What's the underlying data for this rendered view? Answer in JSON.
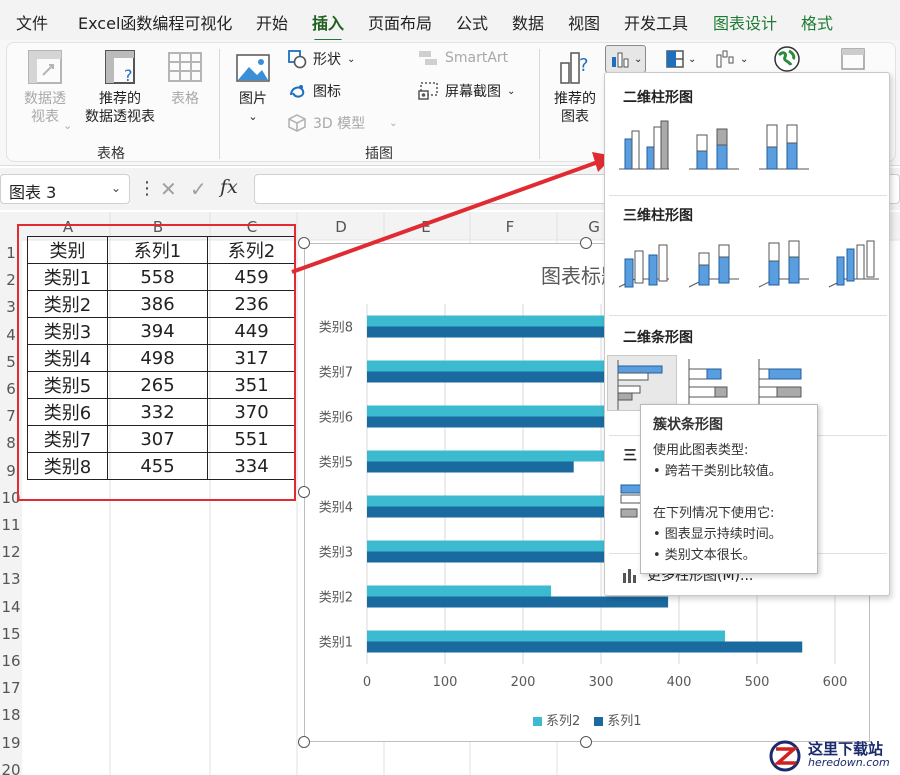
{
  "ribbon": {
    "tabs": [
      {
        "label": "文件"
      },
      {
        "label": "Excel函数编程可视化"
      },
      {
        "label": "开始"
      },
      {
        "label": "插入",
        "active": true
      },
      {
        "label": "页面布局"
      },
      {
        "label": "公式"
      },
      {
        "label": "数据"
      },
      {
        "label": "视图"
      },
      {
        "label": "开发工具"
      },
      {
        "label": "图表设计"
      },
      {
        "label": "格式"
      }
    ],
    "tables_group": {
      "label": "表格",
      "pivot": "数据透\n视表",
      "pivot_dd": "⌄",
      "recommended_pivot": "推荐的\n数据透视表",
      "table": "表格"
    },
    "illustrations_group": {
      "label": "插图",
      "picture": "图片",
      "picture_dd": "⌄",
      "shapes": "形状",
      "icons": "图标",
      "model3d": "3D 模型",
      "smartart": "SmartArt",
      "screenshot": "屏幕截图"
    },
    "charts_group": {
      "recommended_charts": "推荐的\n图表"
    }
  },
  "formula_bar": {
    "name_box": "图表 3",
    "name_dd": "⌄",
    "more": "⋮",
    "cancel": "✕",
    "enter": "✓",
    "fx": "fx",
    "value": ""
  },
  "sheet": {
    "columns": [
      "A",
      "B",
      "C",
      "D",
      "E",
      "F",
      "G"
    ],
    "rows": [
      "1",
      "2",
      "3",
      "4",
      "5",
      "6",
      "7",
      "8",
      "9",
      "10",
      "11",
      "12",
      "13",
      "14",
      "15",
      "16",
      "17",
      "18",
      "19",
      "20"
    ],
    "table_header": [
      "类别",
      "系列1",
      "系列2"
    ],
    "table_rows": [
      [
        "类别1",
        "558",
        "459"
      ],
      [
        "类别2",
        "386",
        "236"
      ],
      [
        "类别3",
        "394",
        "449"
      ],
      [
        "类别4",
        "498",
        "317"
      ],
      [
        "类别5",
        "265",
        "351"
      ],
      [
        "类别6",
        "332",
        "370"
      ],
      [
        "类别7",
        "307",
        "551"
      ],
      [
        "类别8",
        "455",
        "334"
      ]
    ]
  },
  "chart_data": {
    "type": "bar",
    "orientation": "horizontal",
    "title": "图表标题",
    "categories": [
      "类别1",
      "类别2",
      "类别3",
      "类别4",
      "类别5",
      "类别6",
      "类别7",
      "类别8"
    ],
    "series": [
      {
        "name": "系列1",
        "color": "#1a6aa0",
        "values": [
          558,
          386,
          394,
          498,
          265,
          332,
          307,
          455
        ]
      },
      {
        "name": "系列2",
        "color": "#3bbad0",
        "values": [
          459,
          236,
          449,
          317,
          351,
          370,
          551,
          334
        ]
      }
    ],
    "xlim": [
      0,
      600
    ],
    "xticks": [
      0,
      100,
      200,
      300,
      400,
      500,
      600
    ],
    "grid": true,
    "legend": "bottom"
  },
  "dropdown": {
    "section_2d_column": "二维柱形图",
    "section_3d_column": "三维柱形图",
    "section_2d_bar": "二维条形图",
    "section_3d_bar_partial": "三",
    "more_charts": "更多柱形图(M)..."
  },
  "tooltip": {
    "title": "簇状条形图",
    "line1": "使用此图表类型:",
    "line2": "• 跨若干类别比较值。",
    "line3": "在下列情况下使用它:",
    "line4": "• 图表显示持续时间。",
    "line5": "• 类别文本很长。"
  },
  "watermark": {
    "cn": "这里下载站",
    "en": "heredown.com"
  },
  "colors": {
    "accent_green": "#217346",
    "highlight_red": "#e02b33",
    "series1": "#1a6aa0",
    "series2": "#3bbad0"
  }
}
